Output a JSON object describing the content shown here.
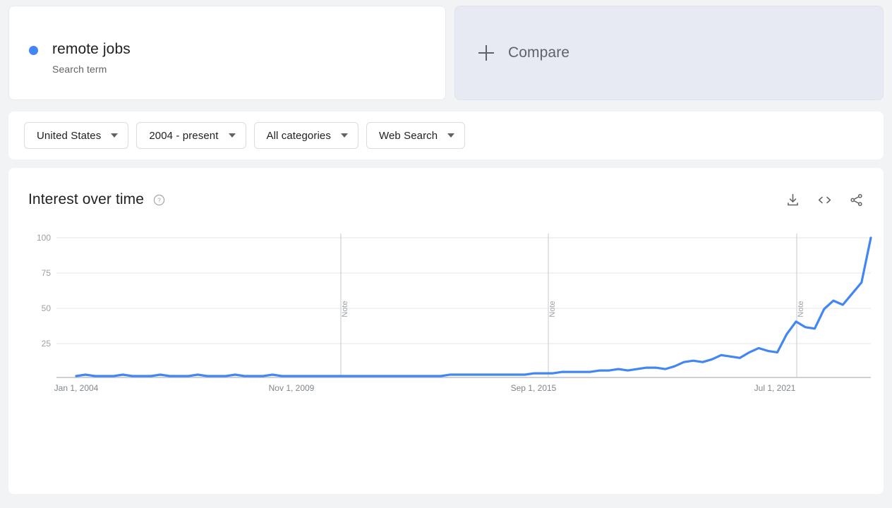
{
  "term": {
    "name": "remote jobs",
    "subtitle": "Search term",
    "dot_color": "#4285f4"
  },
  "compare": {
    "label": "Compare",
    "icon": "plus-icon"
  },
  "filters": [
    {
      "label": "United States",
      "icon": "chevron-down-icon"
    },
    {
      "label": "2004 - present",
      "icon": "chevron-down-icon"
    },
    {
      "label": "All categories",
      "icon": "chevron-down-icon"
    },
    {
      "label": "Web Search",
      "icon": "chevron-down-icon"
    }
  ],
  "chart_panel": {
    "title": "Interest over time",
    "help_icon": "help-circle-icon",
    "actions": [
      {
        "name": "download-icon",
        "title": "Download"
      },
      {
        "name": "embed-code-icon",
        "title": "Embed"
      },
      {
        "name": "share-icon",
        "title": "Share"
      }
    ]
  },
  "chart_data": {
    "type": "line",
    "title": "Interest over time",
    "xlabel": "",
    "ylabel": "",
    "ylim": [
      0,
      100
    ],
    "yticks": [
      25,
      50,
      75,
      100
    ],
    "xticks": [
      "Jan 1, 2004",
      "Nov 1, 2009",
      "Sep 1, 2015",
      "Jul 1, 2021"
    ],
    "grid": true,
    "legend": false,
    "line_color": "#4285f4",
    "series_name": "remote jobs",
    "annotations": [
      {
        "label": "Note",
        "x": "2010-01"
      },
      {
        "label": "Note",
        "x": "2016-01"
      },
      {
        "label": "Note",
        "x": "2022-01"
      }
    ],
    "x": [
      "2004-01",
      "2004-04",
      "2004-07",
      "2004-10",
      "2005-01",
      "2005-04",
      "2005-07",
      "2005-10",
      "2006-01",
      "2006-04",
      "2006-07",
      "2006-10",
      "2007-01",
      "2007-04",
      "2007-07",
      "2007-10",
      "2008-01",
      "2008-04",
      "2008-07",
      "2008-10",
      "2009-01",
      "2009-04",
      "2009-07",
      "2009-10",
      "2010-01",
      "2010-04",
      "2010-07",
      "2010-10",
      "2011-01",
      "2011-04",
      "2011-07",
      "2011-10",
      "2012-01",
      "2012-04",
      "2012-07",
      "2012-10",
      "2013-01",
      "2013-04",
      "2013-07",
      "2013-10",
      "2014-01",
      "2014-04",
      "2014-07",
      "2014-10",
      "2015-01",
      "2015-04",
      "2015-07",
      "2015-10",
      "2016-01",
      "2016-04",
      "2016-07",
      "2016-10",
      "2017-01",
      "2017-04",
      "2017-07",
      "2017-10",
      "2018-01",
      "2018-04",
      "2018-07",
      "2018-10",
      "2019-01",
      "2019-04",
      "2019-07",
      "2019-10",
      "2020-01",
      "2020-04",
      "2020-07",
      "2020-10",
      "2021-01",
      "2021-04",
      "2021-07",
      "2021-10",
      "2022-01",
      "2022-04",
      "2022-07",
      "2022-10",
      "2023-01",
      "2023-04",
      "2023-07",
      "2023-10",
      "2024-01",
      "2024-04",
      "2024-07",
      "2024-10",
      "2025-01"
    ],
    "values": [
      1,
      2,
      1,
      1,
      1,
      2,
      1,
      1,
      1,
      2,
      1,
      1,
      1,
      2,
      1,
      1,
      1,
      2,
      1,
      1,
      1,
      2,
      1,
      1,
      1,
      1,
      1,
      1,
      1,
      1,
      1,
      1,
      1,
      1,
      1,
      1,
      1,
      1,
      1,
      1,
      2,
      2,
      2,
      2,
      2,
      2,
      2,
      2,
      2,
      3,
      3,
      3,
      4,
      4,
      4,
      4,
      5,
      5,
      6,
      5,
      6,
      7,
      7,
      6,
      8,
      11,
      12,
      11,
      13,
      16,
      15,
      14,
      18,
      21,
      19,
      18,
      31,
      40,
      36,
      35,
      49,
      55,
      52,
      60,
      68
    ],
    "peak_value": 100,
    "peak_label": "100"
  }
}
